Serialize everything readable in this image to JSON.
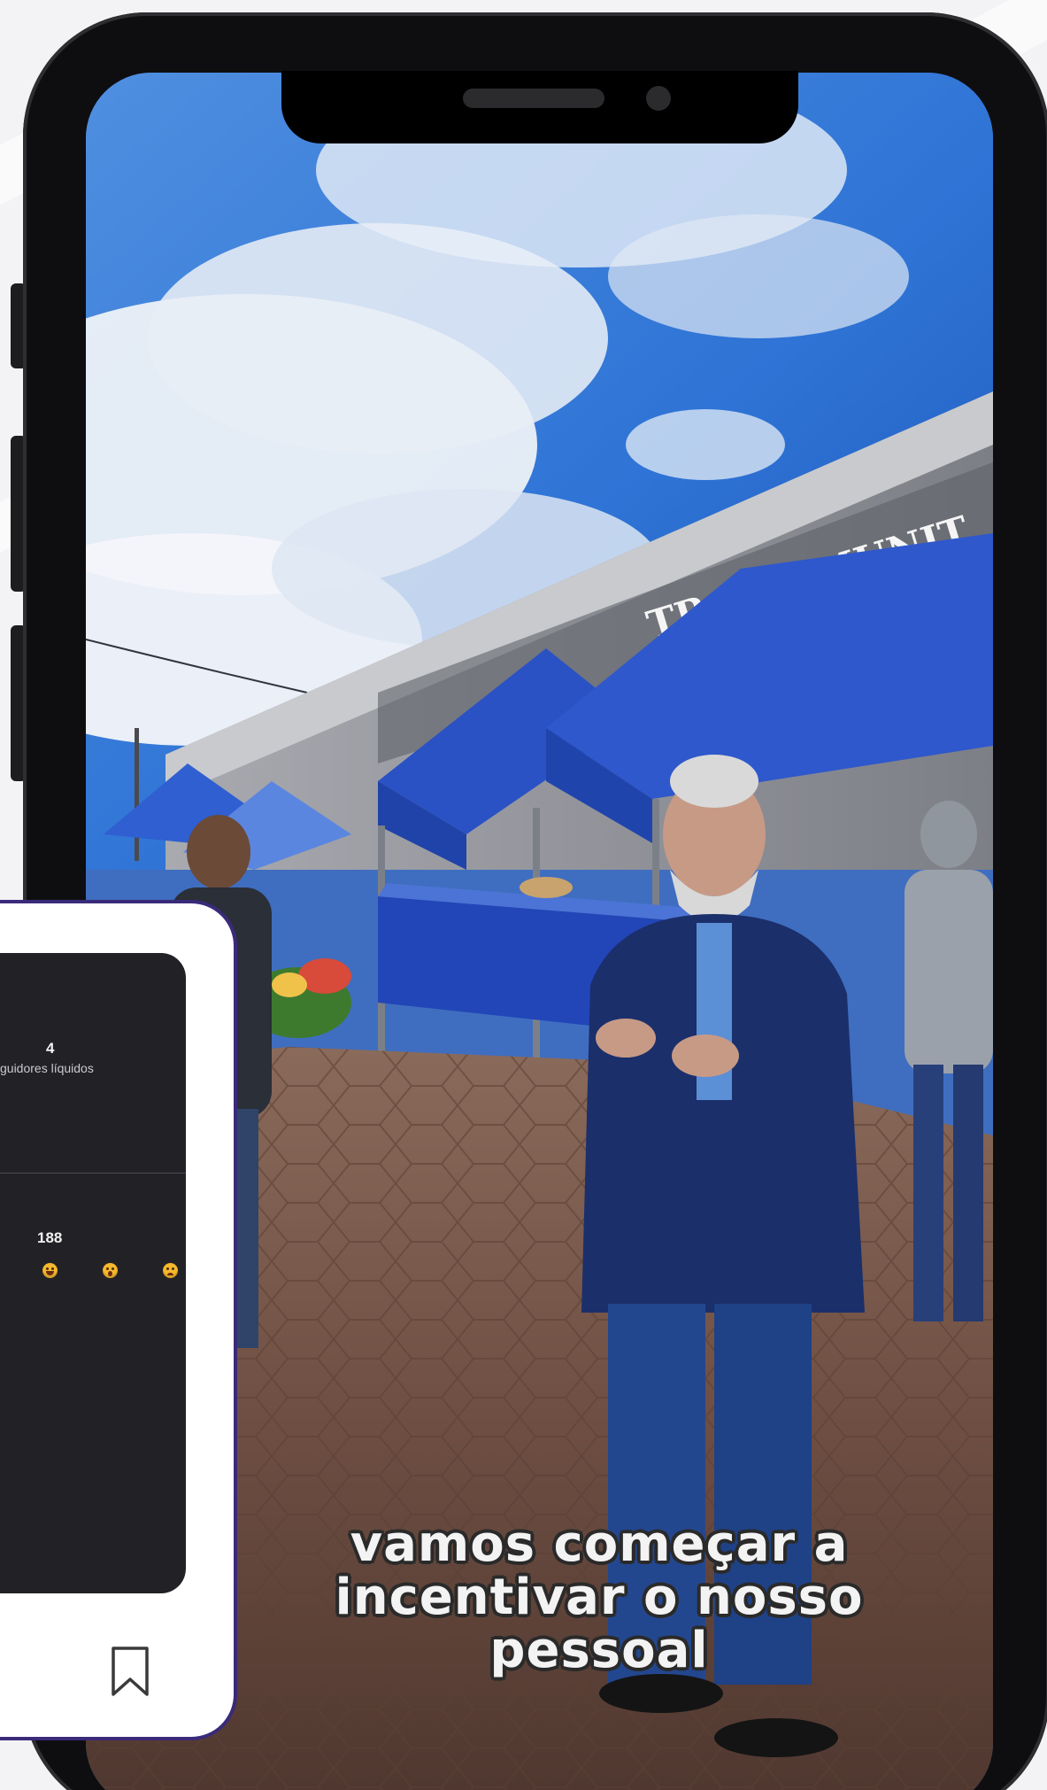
{
  "video": {
    "caption_lines": [
      "vamos começar a",
      "incentivar o nosso",
      "pessoal"
    ],
    "sign_text": "TRO COMUNIT"
  },
  "insights_card": {
    "followers_value": "4",
    "followers_label": "guidores líquidos",
    "reactions_value": "188",
    "reactions": [
      "laugh-emoji",
      "wow-emoji",
      "sad-emoji"
    ],
    "bookmark_icon": "bookmark-icon"
  },
  "colors": {
    "card_border": "#3a2a7a",
    "panel_bg": "#222226",
    "tent_blue": "#2f55c8",
    "sky_blue": "#2d6fd3"
  }
}
